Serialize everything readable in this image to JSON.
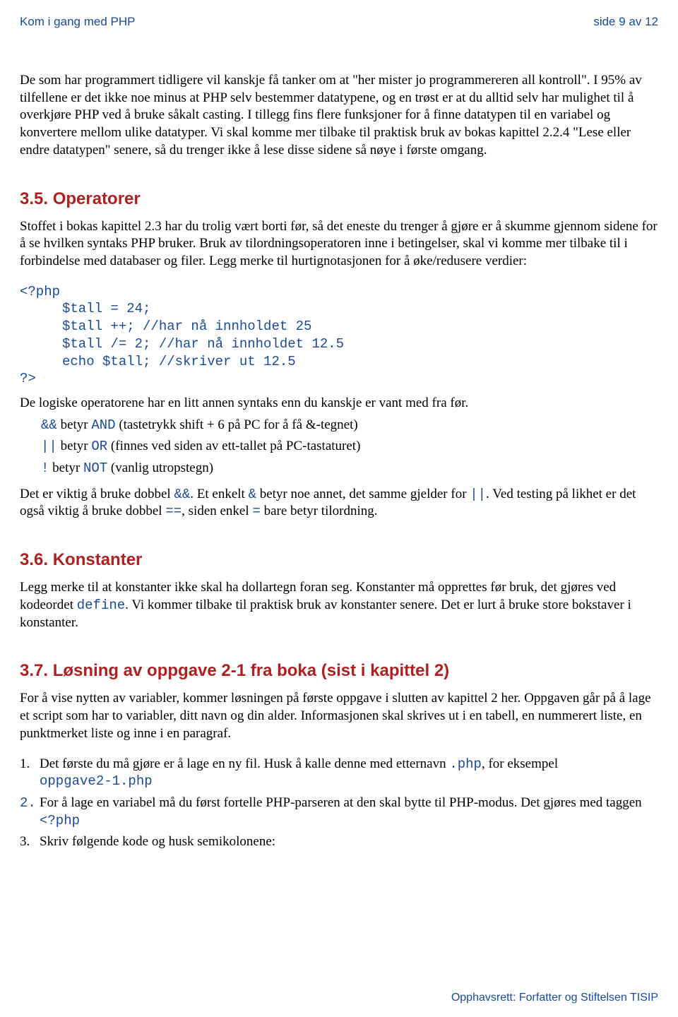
{
  "header": {
    "left": "Kom i gang med PHP",
    "right": "side 9 av 12"
  },
  "intro": "De som har programmert tidligere vil kanskje få tanker om at \"her mister jo programmereren all kontroll\". I 95% av tilfellene er det ikke noe minus at PHP selv bestemmer datatypene, og en trøst er at du alltid selv har mulighet til å overkjøre PHP ved å bruke såkalt casting. I tillegg fins flere funksjoner for å finne datatypen til en variabel og konvertere mellom ulike datatyper. Vi skal komme mer tilbake til praktisk bruk av bokas kapittel 2.2.4 \"Lese eller endre datatypen\" senere, så du trenger ikke å lese disse sidene så nøye i første omgang.",
  "s35": {
    "h": "3.5.   Operatorer",
    "p1": "Stoffet i bokas kapittel 2.3 har du trolig vært borti før, så det eneste du trenger å gjøre er å skumme gjennom sidene for å se hvilken syntaks PHP bruker. Bruk av tilordningsoperatoren inne i betingelser, skal vi komme mer tilbake til i forbindelse med databaser og filer. Legg merke til hurtignotasjonen for å øke/redusere verdier:",
    "code_open": "<?php",
    "code1": "$tall = 24;",
    "code2": "$tall ++; //har nå innholdet 25",
    "code3": "$tall /= 2; //har nå innholdet 12.5",
    "code4": "echo $tall; //skriver ut 12.5",
    "code_close": "?>",
    "p2": "De logiske operatorene har en litt annen syntaks enn du kanskje er vant med fra før.",
    "op_and_a": "&&",
    "op_and_b": " betyr ",
    "op_and_c": "AND",
    "op_and_d": " (tastetrykk shift + 6 på PC for å få &-tegnet)",
    "op_or_a": "||",
    "op_or_b": " betyr ",
    "op_or_c": "OR",
    "op_or_d": " (finnes ved siden av ett-tallet på PC-tastaturet)",
    "op_not_a": "!",
    "op_not_b": " betyr ",
    "op_not_c": "NOT",
    "op_not_d": "  (vanlig utropstegn)",
    "p3a": "Det er viktig å bruke dobbel ",
    "p3b": "&&",
    "p3c": ". Et enkelt ",
    "p3d": "&",
    "p3e": " betyr noe annet, det samme gjelder for ",
    "p3f": "||",
    "p3g": ".",
    "p4a": "Ved testing på likhet er det også viktig å bruke dobbel ",
    "p4b": "==",
    "p4c": ", siden enkel ",
    "p4d": "=",
    "p4e": " bare betyr tilordning."
  },
  "s36": {
    "h": "3.6.   Konstanter",
    "p1a": "Legg merke til at konstanter ikke skal ha dollartegn foran seg. Konstanter må opprettes før bruk, det gjøres ved kodeordet ",
    "p1b": "define",
    "p1c": ". Vi kommer tilbake til praktisk bruk av konstanter senere. Det er lurt å bruke store bokstaver i konstanter."
  },
  "s37": {
    "h": "3.7.   Løsning av oppgave 2-1 fra boka (sist i kapittel 2)",
    "p1": "For å vise nytten av variabler, kommer løsningen på første oppgave i slutten av kapittel 2 her. Oppgaven går på å lage et script som har to variabler, ditt navn og din alder. Informasjonen skal skrives ut i en tabell, en nummerert liste, en punktmerket liste og inne i en paragraf.",
    "n1": "1.",
    "li1a": "Det første du må gjøre er å lage en ny fil. Husk å kalle denne med etternavn ",
    "li1b": ".php",
    "li1c": ", for eksempel ",
    "li1d": "oppgave2-1.php",
    "n2": "2.",
    "li2a": "For å lage en variabel må du først fortelle PHP-parseren at den skal bytte til PHP-modus. Det gjøres med taggen ",
    "li2b": "<?php",
    "n3": "3.",
    "li3": "Skriv følgende kode og husk semikolonene:"
  },
  "footer": "Opphavsrett:  Forfatter og Stiftelsen TISIP"
}
